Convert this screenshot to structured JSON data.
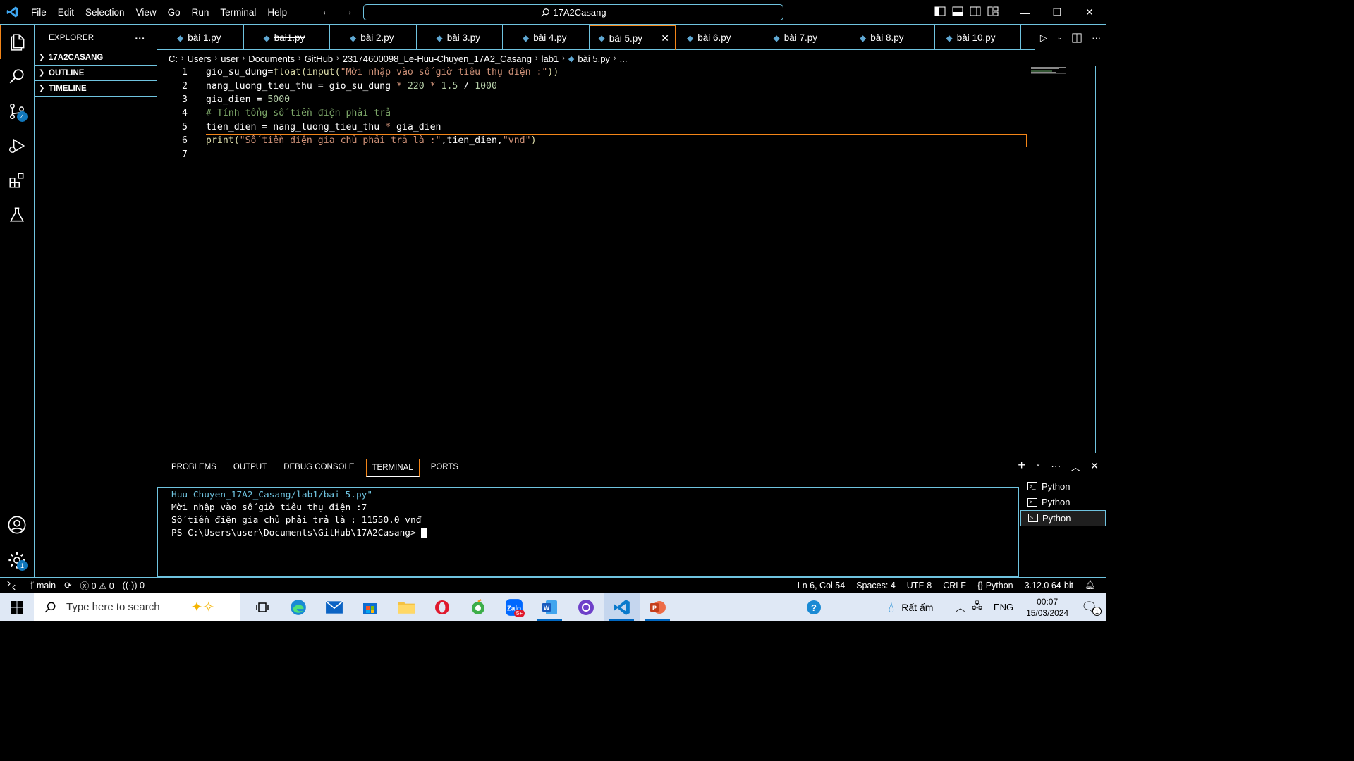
{
  "titlebar": {
    "menu": [
      "File",
      "Edit",
      "Selection",
      "View",
      "Go",
      "Run",
      "Terminal",
      "Help"
    ],
    "search_text": "17A2Casang"
  },
  "activity": {
    "source_control_badge": "4",
    "settings_badge": "1"
  },
  "sidebar": {
    "title": "EXPLORER",
    "more": "···",
    "sections": [
      "17A2CASANG",
      "OUTLINE",
      "TIMELINE"
    ]
  },
  "tabs": [
    {
      "label": "bài 1.py"
    },
    {
      "label": "bai1.py"
    },
    {
      "label": "bài 2.py"
    },
    {
      "label": "bài 3.py"
    },
    {
      "label": "bài 4.py"
    },
    {
      "label": "bài 5.py"
    },
    {
      "label": "bài 6.py"
    },
    {
      "label": "bài 7.py"
    },
    {
      "label": "bài 8.py"
    },
    {
      "label": "bài 10.py"
    }
  ],
  "active_tab": "bài 5.py",
  "breadcrumb": [
    "C:",
    "Users",
    "user",
    "Documents",
    "GitHub",
    "23174600098_Le-Huu-Chuyen_17A2_Casang",
    "lab1",
    "bài 5.py",
    "..."
  ],
  "editor": {
    "line_numbers": [
      "1",
      "2",
      "3",
      "4",
      "5",
      "6",
      "7"
    ],
    "current_line": 6
  },
  "code": {
    "l1": [
      "gio_su_dung",
      "=",
      "float",
      "(",
      "input",
      "(",
      "\"Mời nhập vào số giờ tiêu thụ điện :\"",
      "))"
    ],
    "l2": [
      "nang_luong_tieu_thu",
      " = ",
      "gio_su_dung",
      " * ",
      "220",
      " * ",
      "1.5",
      " / ",
      "1000"
    ],
    "l3": [
      "gia_dien",
      " = ",
      "5000"
    ],
    "l4": "# Tính tổng số tiền điện phải trả",
    "l5": [
      "tien_dien",
      " = ",
      "nang_luong_tieu_thu",
      " * ",
      "gia_dien"
    ],
    "l6": [
      "print",
      "(",
      "\"Số tiền điện gia chủ phải trả là :\"",
      ",",
      "tien_dien",
      ",",
      "\"vnđ\"",
      ")"
    ]
  },
  "panel": {
    "tabs": [
      "PROBLEMS",
      "OUTPUT",
      "DEBUG CONSOLE",
      "TERMINAL",
      "PORTS"
    ],
    "active_tab": "TERMINAL",
    "terminal_lines": [
      "Huu-Chuyen_17A2_Casang/lab1/bai 5.py\"",
      "Mời nhập vào số giờ tiêu thụ điện :7",
      "Số tiền điện gia chủ phải trả là : 11550.0 vnđ",
      "PS C:\\Users\\user\\Documents\\GitHub\\17A2Casang> "
    ],
    "terminals": [
      "Python",
      "Python",
      "Python"
    ]
  },
  "statusbar": {
    "branch": "main",
    "errors": "0",
    "warnings": "0",
    "ports": "0",
    "position": "Ln 6, Col 54",
    "spaces": "Spaces: 4",
    "encoding": "UTF-8",
    "eol": "CRLF",
    "language": "Python",
    "interpreter": "3.12.0 64-bit"
  },
  "taskbar": {
    "search_placeholder": "Type here to search",
    "weather": "Rất ấm",
    "lang": "ENG",
    "time": "00:07",
    "date": "15/03/2024",
    "zalo_badge": "5+",
    "notif_count": "1"
  },
  "colors": {
    "hc_border": "#6fc3df",
    "hc_active": "#f38518",
    "string": "#ce9178",
    "number": "#b5cea8",
    "function": "#dcdcaa",
    "comment": "#7ca668"
  }
}
